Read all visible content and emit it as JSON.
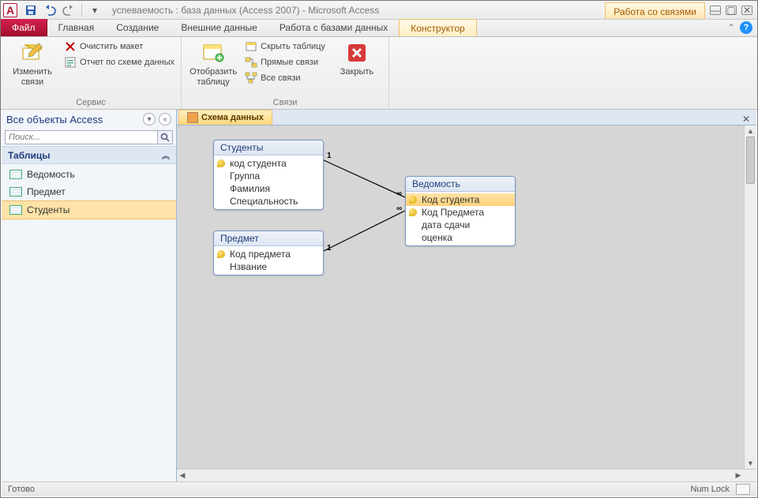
{
  "title": "успеваемость : база данных (Access 2007)  -  Microsoft Access",
  "context_group_title": "Работа со связями",
  "tabs": {
    "file": "Файл",
    "home": "Главная",
    "create": "Создание",
    "external": "Внешние данные",
    "db_tools": "Работа с базами данных",
    "design": "Конструктор"
  },
  "ribbon": {
    "group_service": "Сервис",
    "group_relations": "Связи",
    "edit_relations": "Изменить связи",
    "clear_layout": "Очистить макет",
    "relationships_report": "Отчет по схеме данных",
    "show_table": "Отобразить таблицу",
    "hide_table": "Скрыть таблицу",
    "direct_relations": "Прямые связи",
    "all_relations": "Все связи",
    "close": "Закрыть"
  },
  "nav": {
    "header": "Все объекты Access",
    "search_placeholder": "Поиск...",
    "category": "Таблицы",
    "items": [
      {
        "label": "Ведомость"
      },
      {
        "label": "Предмет"
      },
      {
        "label": "Студенты",
        "selected": true
      }
    ]
  },
  "doc_tab": "Схема данных",
  "diagram": {
    "students": {
      "title": "Студенты",
      "fields": [
        {
          "name": "код студента",
          "key": true
        },
        {
          "name": "Группа"
        },
        {
          "name": "Фамилия"
        },
        {
          "name": "Специальность"
        }
      ]
    },
    "subject": {
      "title": "Предмет",
      "fields": [
        {
          "name": "Код предмета",
          "key": true
        },
        {
          "name": "Нзвание"
        }
      ]
    },
    "sheet": {
      "title": "Ведомость",
      "fields": [
        {
          "name": "Код студента",
          "key": true,
          "selected": true
        },
        {
          "name": "Код Предмета",
          "key": true
        },
        {
          "name": "дата сдачи"
        },
        {
          "name": "оценка"
        }
      ]
    },
    "rel_one": "1",
    "rel_many": "∞"
  },
  "status": {
    "ready": "Готово",
    "numlock": "Num Lock"
  }
}
